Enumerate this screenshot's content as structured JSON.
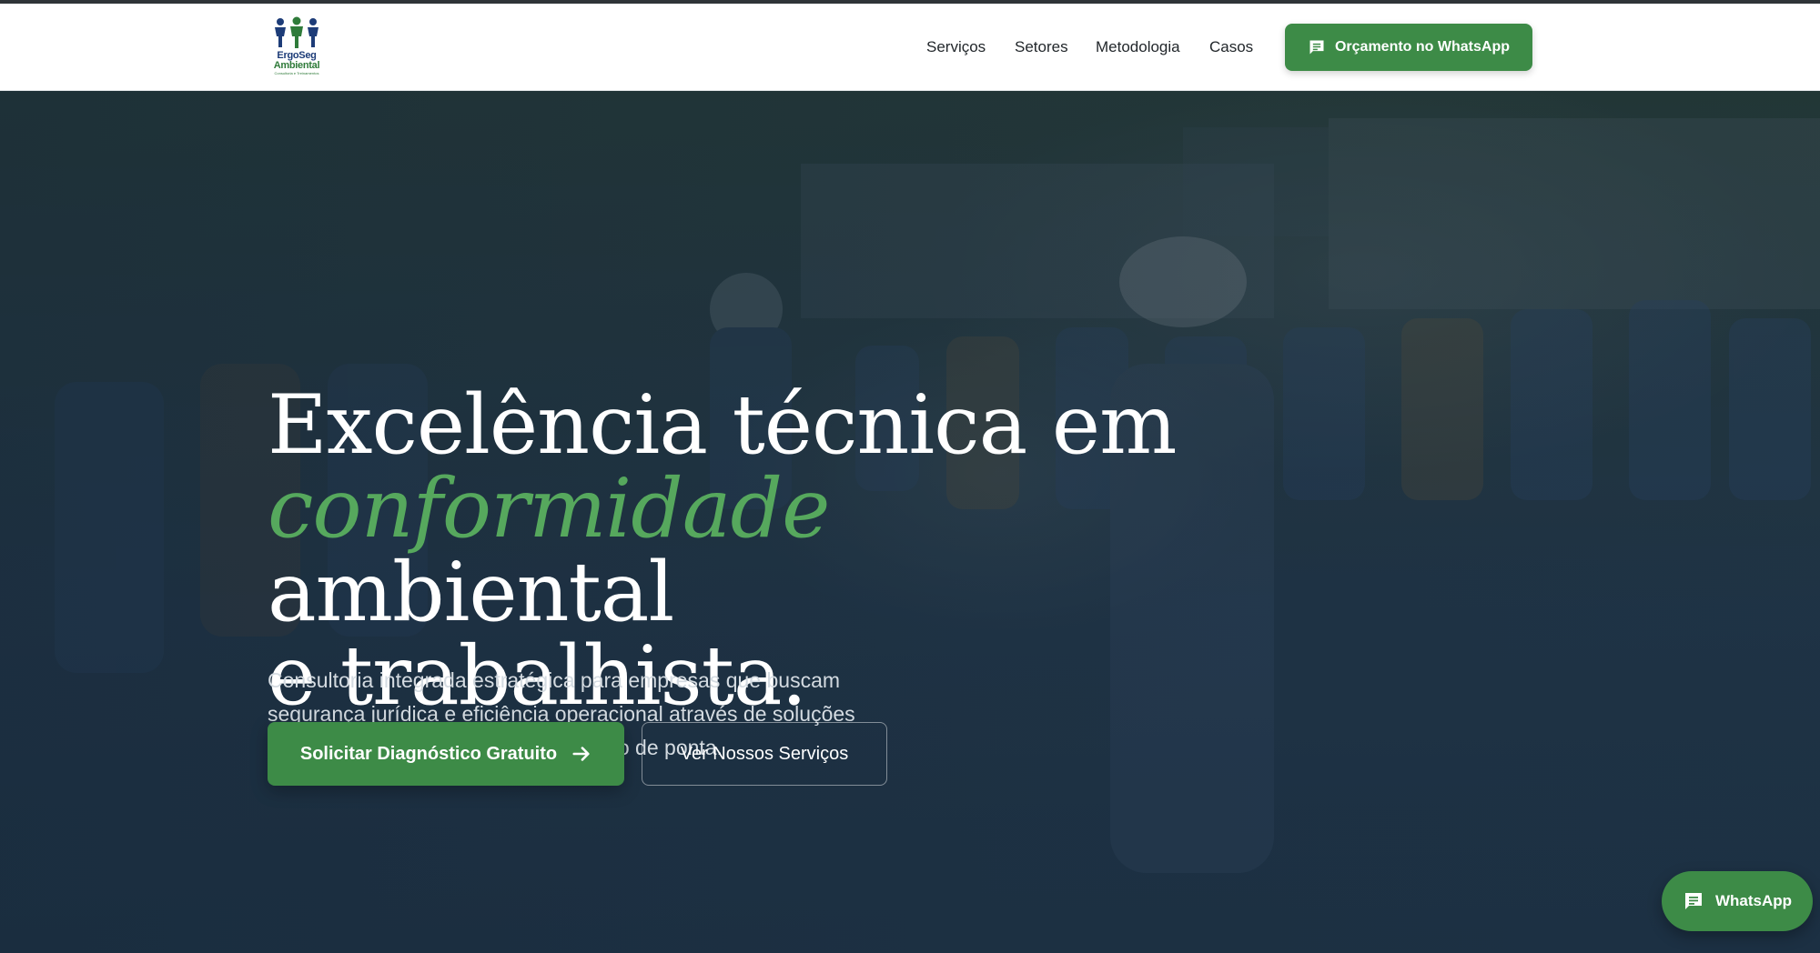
{
  "brand": {
    "logo_line1": "ErgoSeg",
    "logo_line2": "Ambiental",
    "logo_tagline": "Consultoria e Treinamentos",
    "primary_color": "#3d8b47",
    "accent_text_color": "#56a85d"
  },
  "nav": {
    "items": [
      {
        "label": "Serviços"
      },
      {
        "label": "Setores"
      },
      {
        "label": "Metodologia"
      },
      {
        "label": "Casos"
      }
    ],
    "cta_label": "Orçamento no WhatsApp",
    "cta_icon": "chat-icon"
  },
  "hero": {
    "headline_line1": "Excelência técnica em",
    "headline_accent": "conformidade",
    "headline_line2_rest": "ambiental",
    "headline_line3": "e trabalhista.",
    "lead": "Consultoria integrada estratégica para empresas que buscam segurança jurídica e eficiência operacional através de soluções ambientais e de segurança do trabalho de ponta.",
    "primary_button": "Solicitar Diagnóstico Gratuito",
    "primary_button_icon": "arrow-right-icon",
    "secondary_button": "Ver Nossos Serviços"
  },
  "floating_whatsapp": {
    "label": "WhatsApp",
    "icon": "chat-icon"
  }
}
